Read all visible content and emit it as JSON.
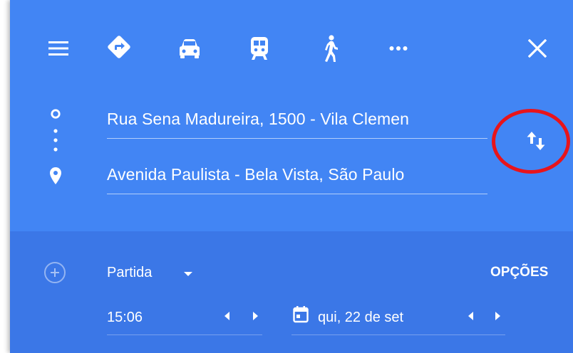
{
  "header": {
    "menu_icon": "menu-icon",
    "modes": [
      {
        "name": "best-route",
        "icon": "directions-diamond-icon"
      },
      {
        "name": "driving",
        "icon": "car-icon"
      },
      {
        "name": "transit",
        "icon": "train-icon"
      },
      {
        "name": "walking",
        "icon": "walk-icon"
      },
      {
        "name": "more",
        "icon": "more-horiz-icon"
      }
    ],
    "close_icon": "close-icon"
  },
  "route": {
    "origin": "Rua Sena Madureira, 1500 - Vila Clemen",
    "destination": "Avenida Paulista - Bela Vista, São Paulo",
    "swap_icon": "swap-icon"
  },
  "options": {
    "add_icon": "add-circle-icon",
    "departure_label": "Partida",
    "options_label": "OPÇÕES",
    "time": "15:06",
    "date": "qui, 22 de set"
  },
  "colors": {
    "header_blue": "#4285f4",
    "options_blue": "#3b77e7",
    "annotation_red": "#e8141b"
  }
}
